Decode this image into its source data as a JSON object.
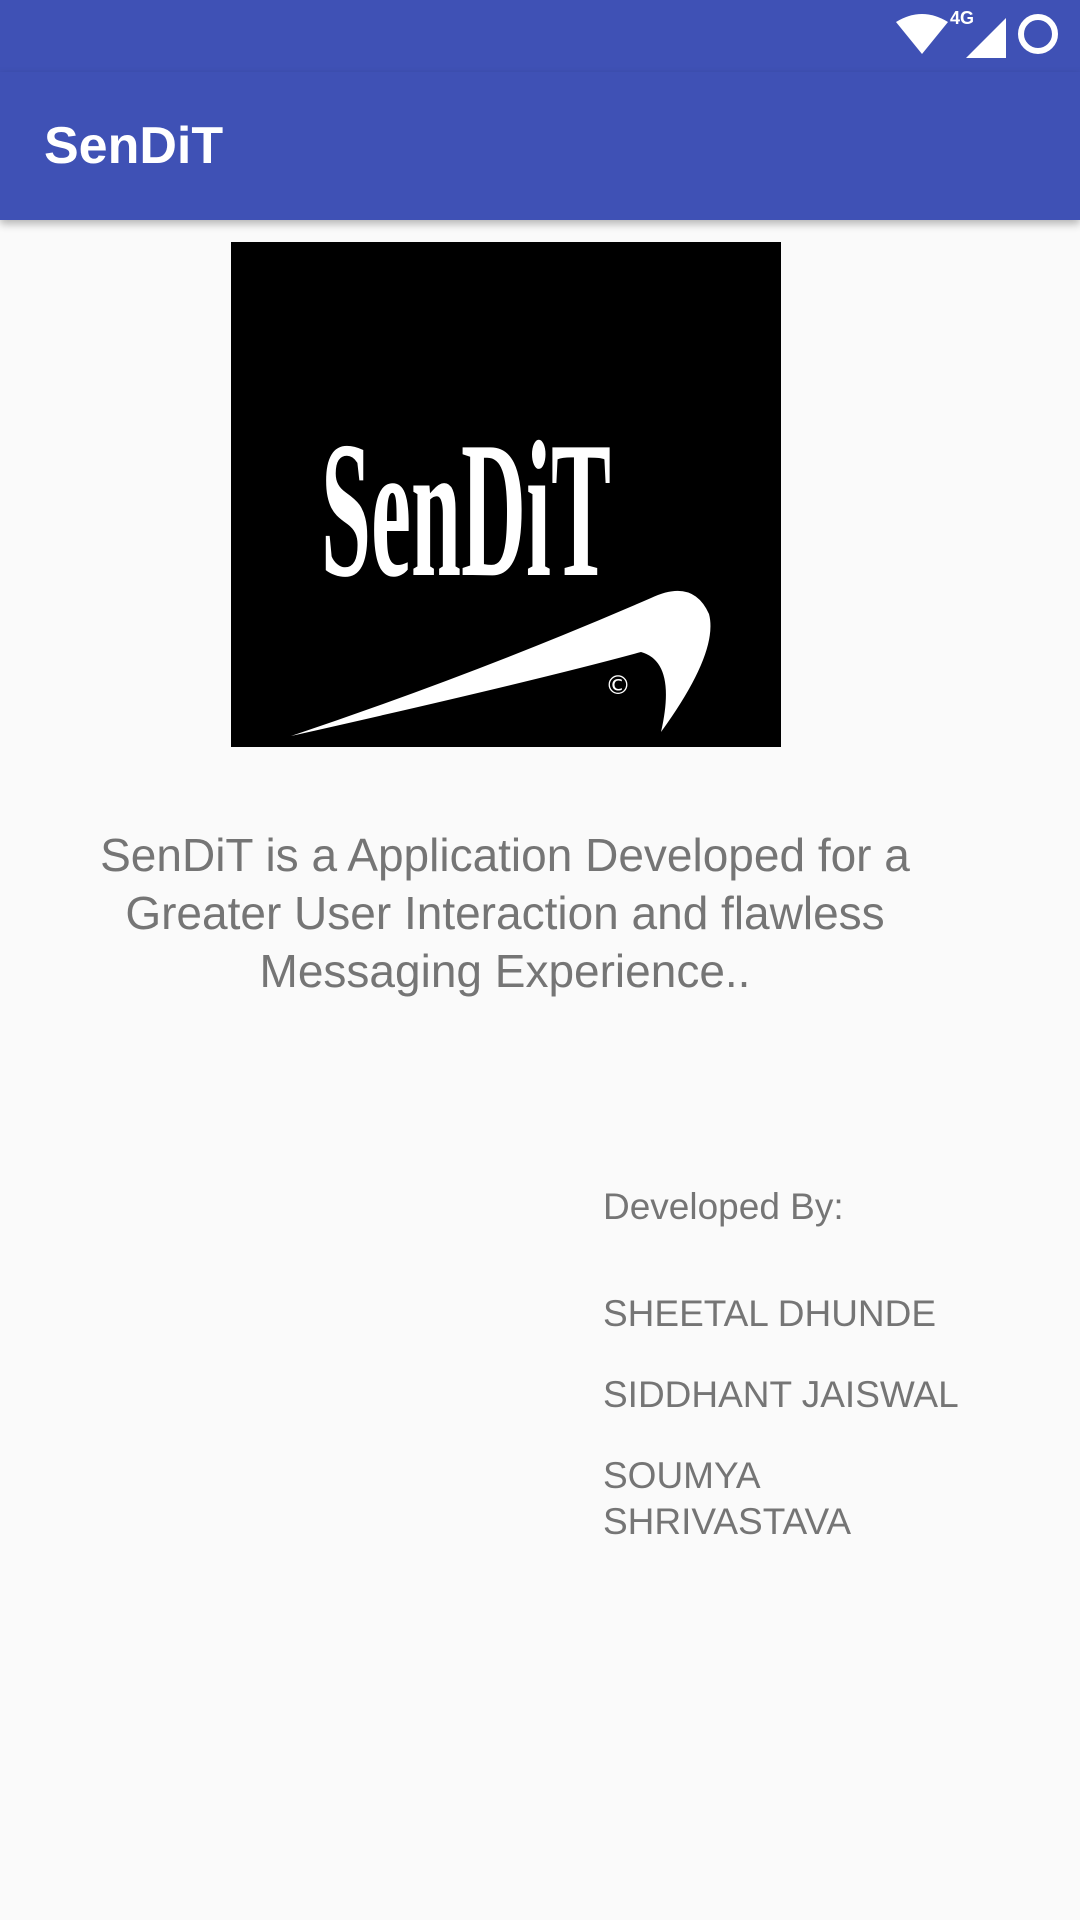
{
  "status_bar": {
    "network_label": "4G",
    "color": "#3f51b5"
  },
  "app_bar": {
    "title": "SenDiT",
    "color": "#3f51b5"
  },
  "logo": {
    "text": "SenDiT",
    "mark": "©"
  },
  "description": "SenDiT is a Application Developed for a Greater User Interaction and flawless Messaging Experience..",
  "developers": {
    "heading": "Developed By:",
    "names": [
      "SHEETAL DHUNDE",
      "SIDDHANT JAISWAL",
      "SOUMYA SHRIVASTAVA"
    ]
  }
}
